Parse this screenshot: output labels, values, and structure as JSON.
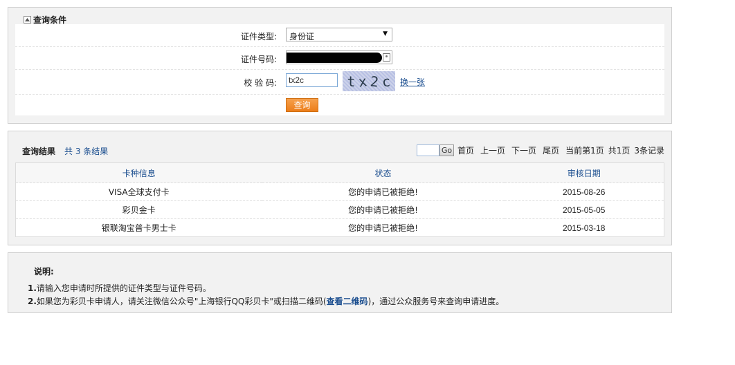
{
  "query_panel": {
    "title": "查询条件",
    "id_type": {
      "label": "证件类型:",
      "value": "身份证"
    },
    "id_number": {
      "label": "证件号码:",
      "value": ""
    },
    "captcha": {
      "label": "校 验 码:",
      "input_value": "tx2c",
      "image_chars": [
        "t",
        "x",
        "2",
        "c"
      ],
      "refresh_label": "换一张"
    },
    "query_button": "查询"
  },
  "results_panel": {
    "title": "查询结果",
    "count_text": "共 3 条结果",
    "pager": {
      "page_input_value": "",
      "go_label": "Go",
      "first": "首页",
      "prev": "上一页",
      "next": "下一页",
      "last": "尾页",
      "current": "当前第1页",
      "total_pages": "共1页",
      "total_records": "3条记录"
    },
    "columns": [
      "卡种信息",
      "状态",
      "审核日期"
    ],
    "rows": [
      [
        "VISA全球支付卡",
        "您的申请已被拒绝!",
        "2015-08-26"
      ],
      [
        "彩贝金卡",
        "您的申请已被拒绝!",
        "2015-05-05"
      ],
      [
        "银联淘宝普卡男士卡",
        "您的申请已被拒绝!",
        "2015-03-18"
      ]
    ]
  },
  "notes": {
    "title": "说明:",
    "line1_num": "1.",
    "line1": "请输入您申请时所提供的证件类型与证件号码。",
    "line2_num": "2.",
    "line2_before": "如果您为彩贝卡申请人，请关注微信公众号\"上海银行QQ彩贝卡\"或扫描二维码(",
    "line2_link": "查看二维码",
    "line2_after": ")，通过公众服务号来查询申请进度。"
  }
}
